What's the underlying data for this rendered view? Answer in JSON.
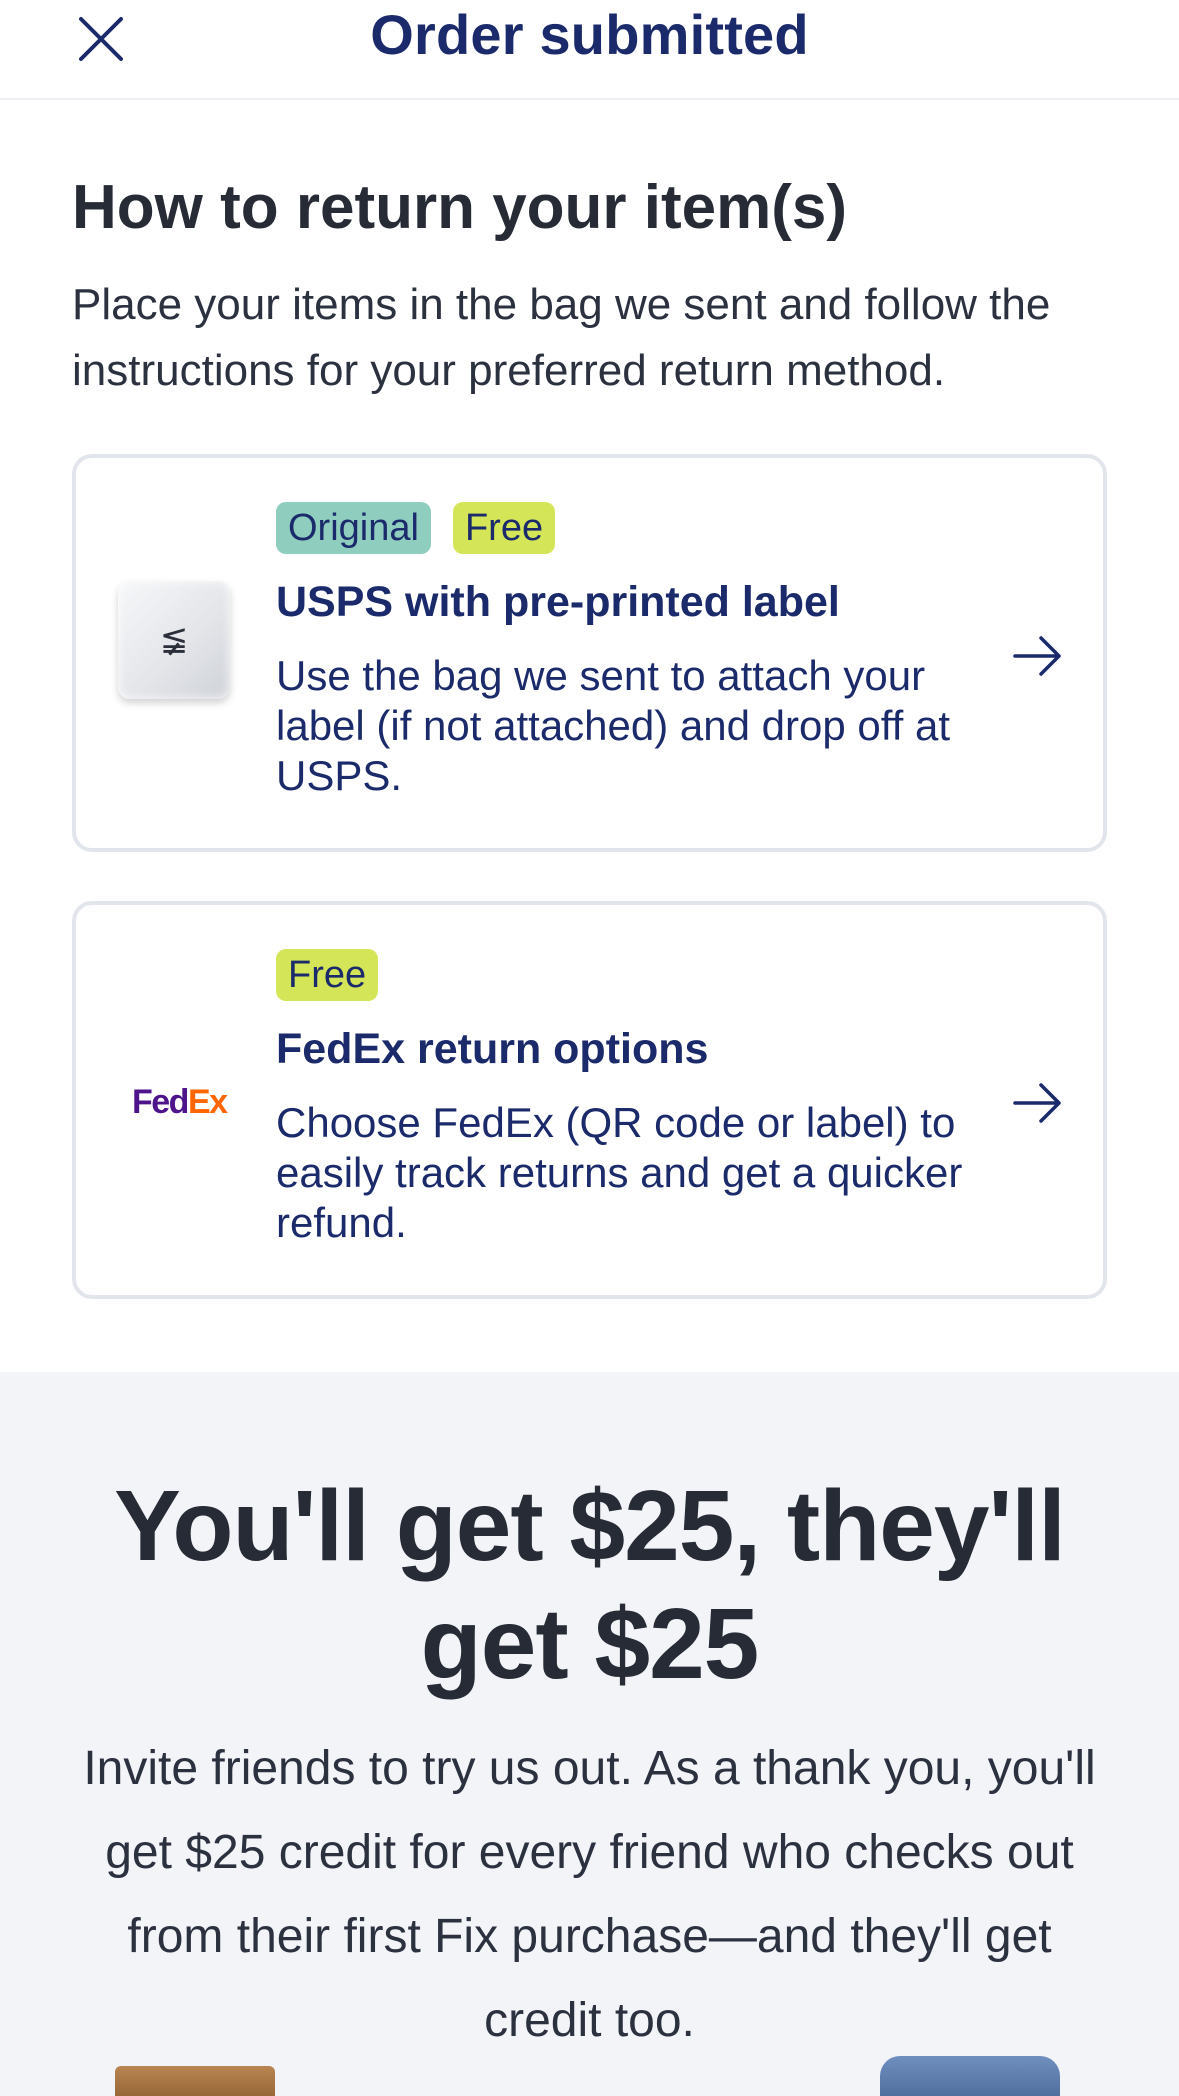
{
  "header": {
    "title": "Order submitted"
  },
  "returns": {
    "title": "How to return your item(s)",
    "description": "Place your items in the bag we sent and follow the instructions for your preferred return method.",
    "options": [
      {
        "badges": [
          "Original",
          "Free"
        ],
        "title": "USPS with pre-printed label",
        "description": "Use the bag we sent to attach your label (if not attached) and drop off at USPS.",
        "thumbnail": "return-bag-image"
      },
      {
        "badges": [
          "Free"
        ],
        "title": "FedEx return options",
        "description": "Choose FedEx (QR code or label) to easily track returns and get a quicker refund.",
        "logo": {
          "part1": "Fed",
          "part2": "Ex"
        }
      }
    ]
  },
  "referral": {
    "title": "You'll get $25, they'll get $25",
    "description": "Invite friends to try us out. As a thank you, you'll get $25 credit for every friend who checks out from their first Fix purchase—and they'll get credit too."
  },
  "icons": {
    "close": "close-icon",
    "arrow": "arrow-right-icon",
    "bag_logo": "≨"
  },
  "colors": {
    "brand_navy": "#1b2a6b",
    "badge_original": "#8fcdbf",
    "badge_free": "#d4e657",
    "fedex_purple": "#4d148c",
    "fedex_orange": "#ff6600"
  }
}
